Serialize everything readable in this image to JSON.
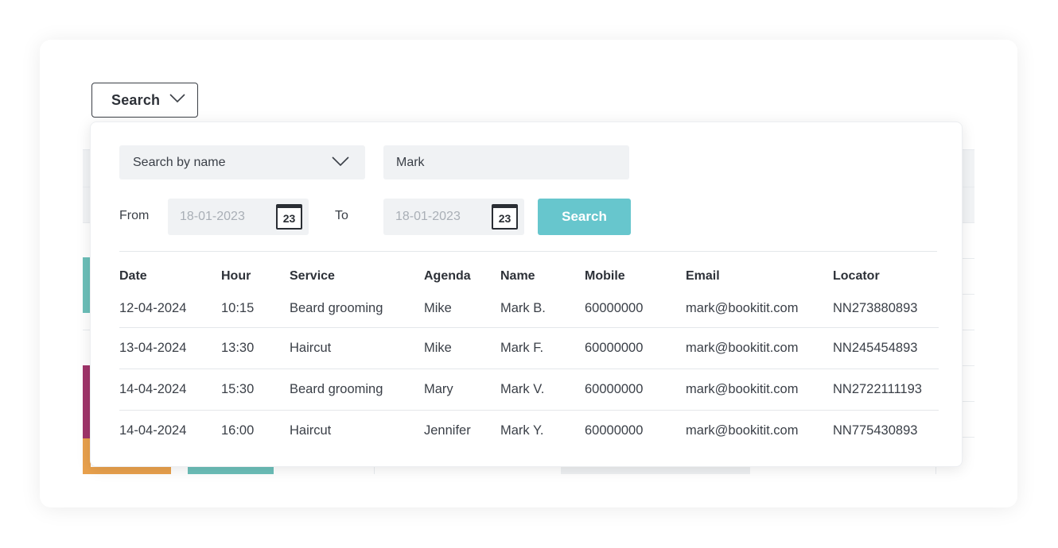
{
  "search_toggle": {
    "label": "Search"
  },
  "filters": {
    "search_by": "Search by name",
    "name_value": "Mark",
    "from_label": "From",
    "from_date": "18-01-2023",
    "to_label": "To",
    "to_date": "18-01-2023",
    "calendar_day": "23",
    "search_button": "Search"
  },
  "table": {
    "columns": [
      "Date",
      "Hour",
      "Service",
      "Agenda",
      "Name",
      "Mobile",
      "Email",
      "Locator"
    ],
    "rows": [
      [
        "12-04-2024",
        "10:15",
        "Beard grooming",
        "Mike",
        "Mark B.",
        "60000000",
        "mark@bookitit.com",
        "NN273880893"
      ],
      [
        "13-04-2024",
        "13:30",
        "Haircut",
        "Mike",
        "Mark F.",
        "60000000",
        "mark@bookitit.com",
        "NN245454893"
      ],
      [
        "14-04-2024",
        "15:30",
        "Beard grooming",
        "Mary",
        "Mark V.",
        "60000000",
        "mark@bookitit.com",
        "NN2722111193"
      ],
      [
        "14-04-2024",
        "16:00",
        "Haircut",
        "Jennifer",
        "Mark Y.",
        "60000000",
        "mark@bookitit.com",
        "NN775430893"
      ]
    ]
  },
  "colors": {
    "accent": "#67c6cd",
    "bg_teal": "#6cbfb9",
    "bg_magenta": "#a0346a",
    "bg_orange": "#e9a14d"
  }
}
